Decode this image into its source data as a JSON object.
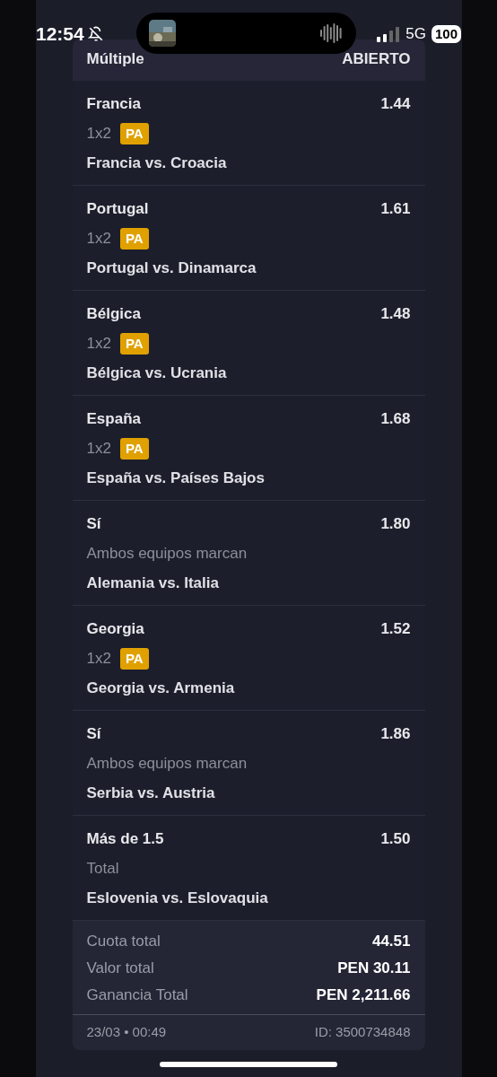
{
  "status_bar": {
    "time": "12:54",
    "network": "5G",
    "battery": "100"
  },
  "bet": {
    "type": "Múltiple",
    "status": "ABIERTO"
  },
  "selections": [
    {
      "pick": "Francia",
      "odds": "1.44",
      "market": "1x2",
      "badge": "PA",
      "match": "Francia vs. Croacia"
    },
    {
      "pick": "Portugal",
      "odds": "1.61",
      "market": "1x2",
      "badge": "PA",
      "match": "Portugal vs. Dinamarca"
    },
    {
      "pick": "Bélgica",
      "odds": "1.48",
      "market": "1x2",
      "badge": "PA",
      "match": "Bélgica vs. Ucrania"
    },
    {
      "pick": "España",
      "odds": "1.68",
      "market": "1x2",
      "badge": "PA",
      "match": "España vs. Países Bajos"
    },
    {
      "pick": "Sí",
      "odds": "1.80",
      "market": "Ambos equipos marcan",
      "match": "Alemania vs. Italia"
    },
    {
      "pick": "Georgia",
      "odds": "1.52",
      "market": "1x2",
      "badge": "PA",
      "match": "Georgia vs. Armenia"
    },
    {
      "pick": "Sí",
      "odds": "1.86",
      "market": "Ambos equipos marcan",
      "match": "Serbia vs. Austria"
    },
    {
      "pick": "Más de 1.5",
      "odds": "1.50",
      "market": "Total",
      "match": "Eslovenia vs. Eslovaquia"
    }
  ],
  "summary": [
    {
      "label": "Cuota total",
      "value": "44.51"
    },
    {
      "label": "Valor total",
      "value": "PEN 30.11"
    },
    {
      "label": "Ganancia Total",
      "value": "PEN 2,211.66"
    }
  ],
  "footer": {
    "date": "23/03 • 00:49",
    "id": "ID: 3500734848"
  }
}
